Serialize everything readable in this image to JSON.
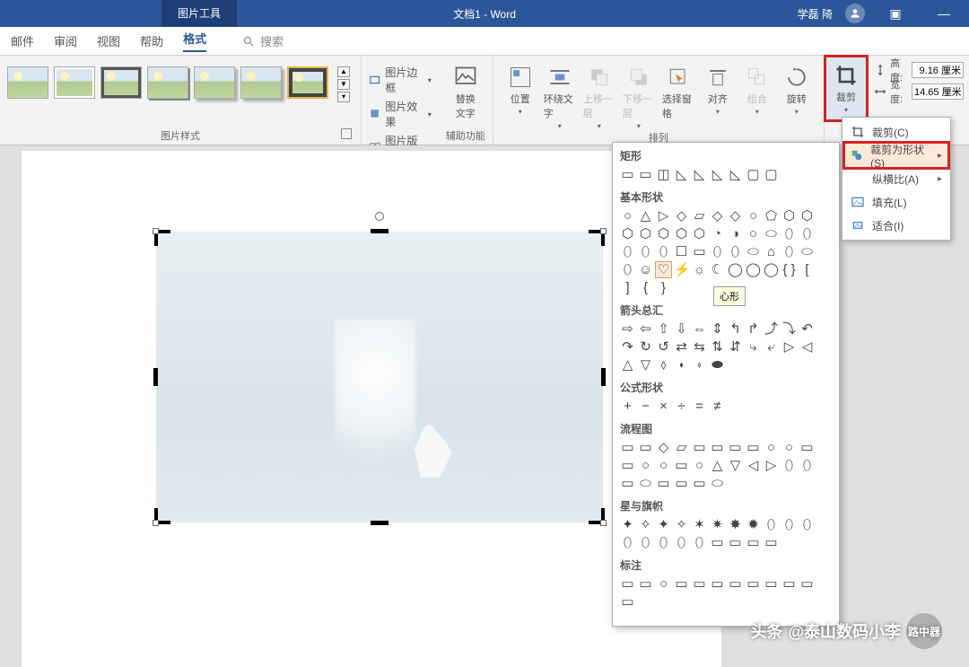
{
  "titlebar": {
    "picture_tools": "图片工具",
    "document": "文档1 - Word",
    "user": "学磊 陭"
  },
  "tabs": {
    "items": [
      "邮件",
      "审阅",
      "视图",
      "帮助",
      "格式"
    ],
    "active_index": 4,
    "search_label": "搜索"
  },
  "ribbon": {
    "styles_group": "图片样式",
    "aux_group": "辅助功能",
    "arrange_group": "排列",
    "border_opt": "图片边框",
    "effect_opt": "图片效果",
    "layout_opt": "图片版式",
    "alt_text": "替换\n文字",
    "position": "位置",
    "wrap": "环绕文字",
    "bring_fwd": "上移一层",
    "send_back": "下移一层",
    "selection_pane": "选择窗格",
    "align": "对齐",
    "group": "组合",
    "rotate": "旋转",
    "crop": "裁剪",
    "height_label": "高度:",
    "height_value": "9.16 厘米",
    "width_label": "宽度:",
    "width_value": "14.65 厘米"
  },
  "crop_menu": {
    "crop": "裁剪(C)",
    "crop_to_shape": "裁剪为形状(S)",
    "aspect": "纵横比(A)",
    "fill": "填充(L)",
    "fit": "适合(I)"
  },
  "shapes": {
    "rectangles": "矩形",
    "basic": "基本形状",
    "arrows": "箭头总汇",
    "formula": "公式形状",
    "flowchart": "流程图",
    "stars": "星与旗帜",
    "callouts": "标注",
    "heart_tooltip": "心形",
    "rect_glyphs": [
      "▭",
      "▭",
      "◫",
      "◺",
      "◺",
      "◺",
      "◺",
      "▢",
      "▢"
    ],
    "basic_glyphs": [
      "○",
      "△",
      "▷",
      "◇",
      "▱",
      "◇",
      "◇",
      "○",
      "⬠",
      "⬡",
      "⬡",
      "⬡",
      "⬡",
      "⬡",
      "⬡",
      "⬡",
      "◔",
      "◑",
      "○",
      "⬭",
      "⬯",
      "⬯",
      "⬯",
      "⬯",
      "⬯",
      "☐",
      "▭",
      "⬯",
      "⬯",
      "⬭",
      "⌂",
      "⬯",
      "⬭",
      "⬯",
      "☺",
      "♡",
      "⚡",
      "☼",
      "☾",
      "◯",
      "◯",
      "◯",
      "{ }",
      "[",
      "]",
      "{",
      "}"
    ],
    "arrow_glyphs": [
      "⇨",
      "⇦",
      "⇧",
      "⇩",
      "⇔",
      "⇕",
      "↰",
      "↱",
      "⤴",
      "⤵",
      "↶",
      "↷",
      "↻",
      "↺",
      "⇄",
      "⇆",
      "⇅",
      "⇵",
      "⤷",
      "⤶",
      "▷",
      "◁",
      "△",
      "▽",
      "⬨",
      "⬪",
      "⬫",
      "⬬"
    ],
    "formula_glyphs": [
      "+",
      "−",
      "×",
      "÷",
      "=",
      "≠"
    ],
    "flow_glyphs": [
      "▭",
      "▭",
      "◇",
      "▱",
      "▭",
      "▭",
      "▭",
      "▭",
      "○",
      "○",
      "▭",
      "▭",
      "○",
      "○",
      "▭",
      "○",
      "△",
      "▽",
      "◁",
      "▷",
      "⬯",
      "⬯",
      "▭",
      "⬭",
      "▭",
      "▭",
      "▭",
      "⬭"
    ],
    "star_glyphs": [
      "✦",
      "✧",
      "✦",
      "✧",
      "✶",
      "✷",
      "✸",
      "✹",
      "⬯",
      "⬯",
      "⬯",
      "⬯",
      "⬯",
      "⬯",
      "⬯",
      "⬯",
      "▭",
      "▭",
      "▭",
      "▭"
    ],
    "callout_glyphs": [
      "▭",
      "▭",
      "○",
      "▭",
      "▭",
      "▭",
      "▭",
      "▭",
      "▭",
      "▭",
      "▭",
      "▭"
    ]
  },
  "watermark": {
    "prefix": "头条",
    "text": "@泰山数码小李",
    "badge": "路中器"
  }
}
